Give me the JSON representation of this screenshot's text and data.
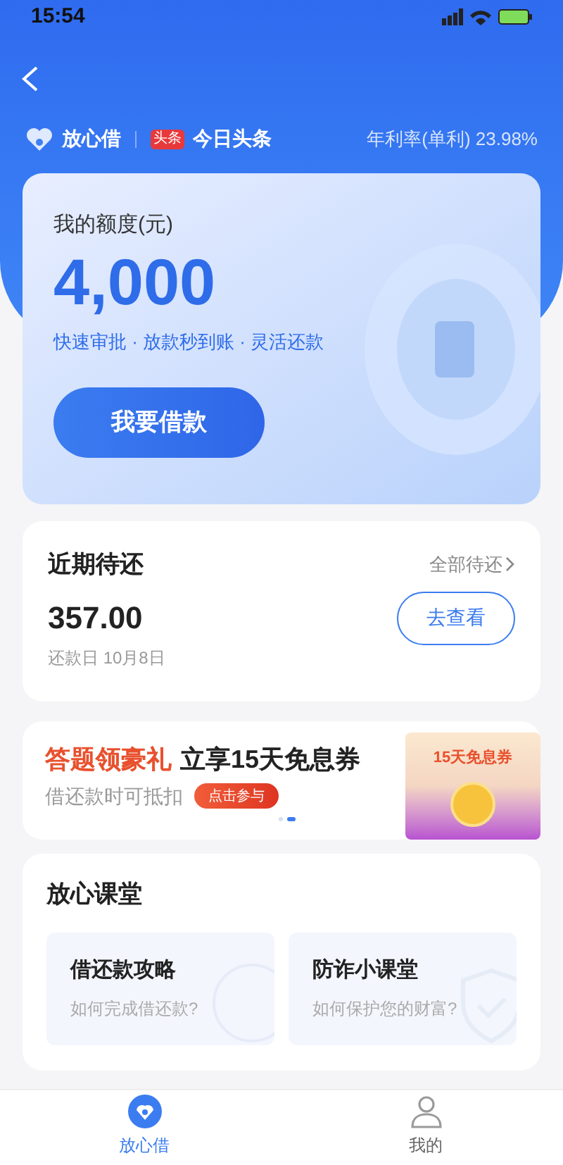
{
  "status_bar": {
    "time": "15:54"
  },
  "header": {
    "brand": "放心借",
    "partner_badge": "头条",
    "partner": "今日头条",
    "rate": "年利率(单利) 23.98%"
  },
  "quota_card": {
    "title": "我的额度(元)",
    "amount": "4,000",
    "features": "快速审批 · 放款秒到账 · 灵活还款",
    "button": "我要借款"
  },
  "repay_card": {
    "title": "近期待还",
    "link": "全部待还",
    "amount": "357.00",
    "due": "还款日 10月8日",
    "button": "去查看"
  },
  "promo": {
    "highlight": "答题领豪礼",
    "headline": "立享15天免息券",
    "subtitle": "借还款时可抵扣",
    "button": "点击参与",
    "coupon": "15天免息券",
    "dots": [
      {
        "selected": false
      },
      {
        "selected": true
      }
    ]
  },
  "classroom": {
    "title": "放心课堂",
    "items": [
      {
        "title": "借还款攻略",
        "subtitle": "如何完成借还款?",
        "kind": "money"
      },
      {
        "title": "防诈小课堂",
        "subtitle": "如何保护您的财富?",
        "kind": "shield"
      }
    ]
  },
  "tab_bar": [
    {
      "label": "放心借",
      "selected": true,
      "kind": "home"
    },
    {
      "label": "我的",
      "selected": false,
      "kind": "profile"
    }
  ]
}
